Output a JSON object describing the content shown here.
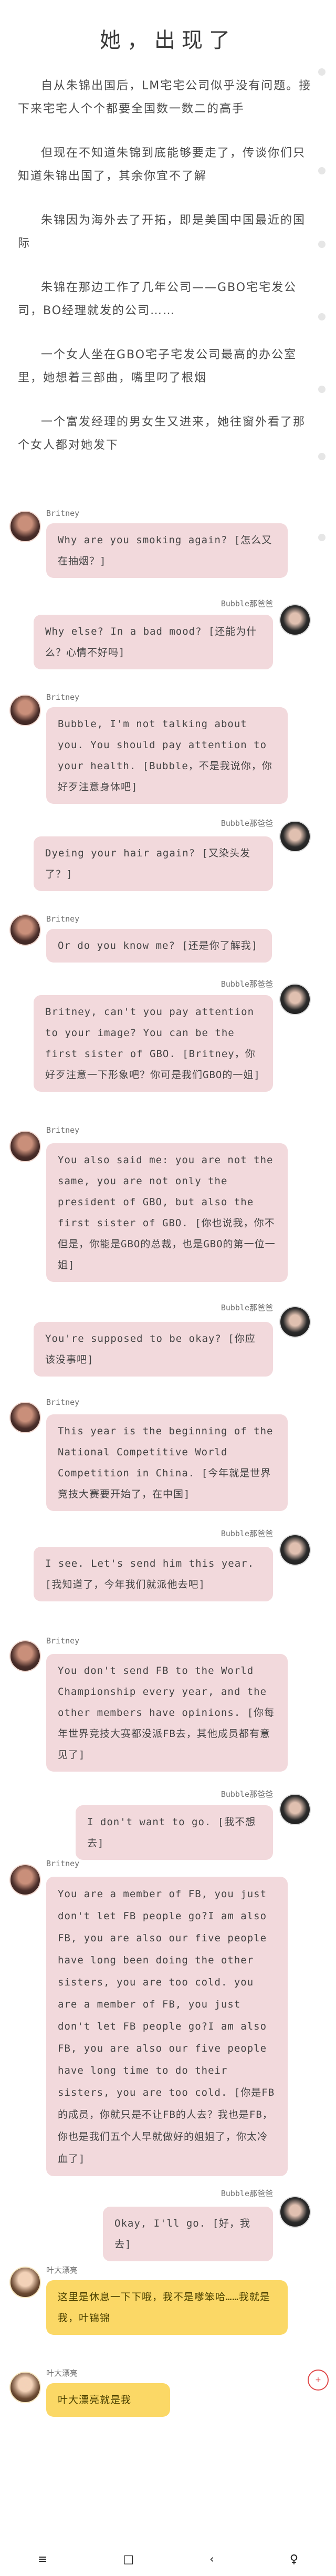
{
  "article": {
    "title": "她，出现了",
    "paragraphs": [
      "自从朱锦出国后，LM宅宅公司似乎没有问题。接下来宅宅人个个都要全国数一数二的高手",
      "但现在不知道朱锦到底能够要走了，传谈你们只知道朱锦出国了，其余你宜不了解",
      "朱锦因为海外去了开拓，即是美国中国最近的国际",
      "朱锦在那边工作了几年公司——GBO宅宅发公司，BO经理就发的公司……",
      "一个女人坐在GBO宅子宅发公司最高的办公室里，她想着三部曲，嘴里叼了根烟",
      "一个富发经理的男女生又进来，她往窗外看了那个女人都对她发下"
    ]
  },
  "chat": [
    {
      "sender": "Britney",
      "side": "left",
      "color": "pink",
      "text": "Why are you smoking again? [怎么又在抽烟？]"
    },
    {
      "sender": "Bubble那爸爸",
      "side": "right",
      "color": "pink",
      "text": "Why else? In a bad mood? [还能为什么？心情不好吗]"
    },
    {
      "sender": "Britney",
      "side": "left",
      "color": "pink",
      "text": "Bubble, I'm not talking about you. You should pay attention to your health. [Bubble，不是我说你，你好歹注意身体吧]"
    },
    {
      "sender": "Bubble那爸爸",
      "side": "right",
      "color": "pink",
      "text": "Dyeing your hair again? [又染头发了？]"
    },
    {
      "sender": "Britney",
      "side": "left",
      "color": "pink",
      "text": "Or do you know me? [还是你了解我]"
    },
    {
      "sender": "Bubble那爸爸",
      "side": "right",
      "color": "pink",
      "text": "Britney, can't you pay attention to your image? You can be the first sister of GBO. [Britney，你好歹注意一下形象吧？你可是我们GBO的一姐]"
    },
    {
      "sender": "Britney",
      "side": "left",
      "color": "pink",
      "text": "You also said me: you are not the same, you are not only the president of GBO, but also the first sister of GBO. [你也说我，你不但是，你能是GBO的总裁，也是GBO的第一位一姐]"
    },
    {
      "sender": "Bubble那爸爸",
      "side": "right",
      "color": "pink",
      "text": "You're supposed to be okay? [你应该没事吧]"
    },
    {
      "sender": "Britney",
      "side": "left",
      "color": "pink",
      "text": "This year is the beginning of the National Competitive World Competition in China. [今年就是世界竞技大赛要开始了，在中国]"
    },
    {
      "sender": "Bubble那爸爸",
      "side": "right",
      "color": "pink",
      "text": "I see. Let's send him this year. [我知道了，今年我们就派他去吧]"
    },
    {
      "sender": "Britney",
      "side": "left",
      "color": "pink",
      "text": "You don't send FB to the World Championship every year, and the other members have opinions. [你每年世界竞技大赛都没派FB去，其他成员都有意见了]"
    },
    {
      "sender": "Bubble那爸爸",
      "side": "right",
      "color": "pink",
      "text": "I don't want to go. [我不想去]"
    },
    {
      "sender": "Britney",
      "side": "left",
      "color": "pink",
      "text": "You are a member of FB, you just don't let FB people go?I am also FB, you are also our five people have long been doing the other sisters, you are too cold. you are a member of FB, you just don't let FB people go?I am also FB, you are also our five people have long time to do their sisters, you are too cold. [你是FB的成员，你就只是不让FB的人去？我也是FB，你也是我们五个人早就做好的姐姐了，你太冷血了]"
    },
    {
      "sender": "Bubble那爸爸",
      "side": "right",
      "color": "pink",
      "text": "Okay, I'll go. [好，我去]"
    },
    {
      "sender": "叶大漂亮",
      "side": "left",
      "color": "yellow",
      "text": "这里是休息一下下哦，我不是嗲笨哈……我就是我，叶锦锦"
    },
    {
      "sender": "叶大漂亮",
      "side": "left",
      "color": "yellow",
      "text": "叶大漂亮就是我"
    }
  ],
  "nav": {
    "menu": "≡",
    "home": "□",
    "back": "‹",
    "person": "♀"
  },
  "float_button": "+"
}
